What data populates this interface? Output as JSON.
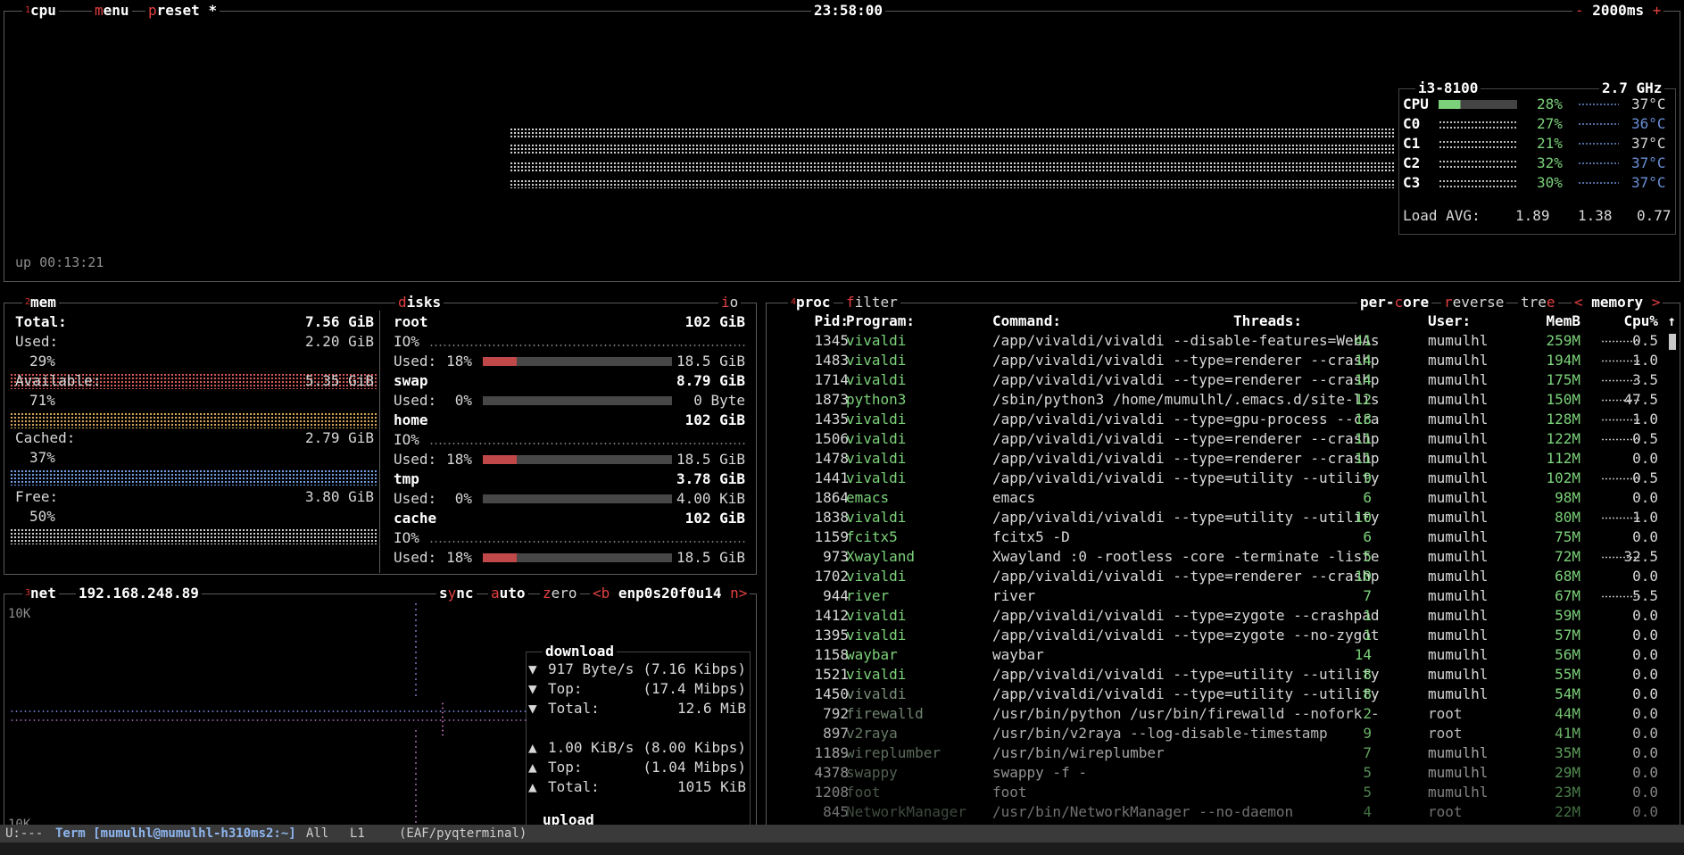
{
  "cpu": {
    "num": "1",
    "title": "cpu",
    "menu": "menu",
    "preset": "preset *",
    "clock": "23:58:00",
    "minus": "-",
    "interval": "2000ms",
    "plus": "+",
    "uptime": "up 00:13:21",
    "model": "i3-8100",
    "freq": "2.7 GHz",
    "cores": [
      {
        "label": "CPU",
        "pct": "28%",
        "temp": "37°C",
        "usage": 0.28
      },
      {
        "label": "C0",
        "pct": "27%",
        "temp": "36°C",
        "usage": 0.27
      },
      {
        "label": "C1",
        "pct": "21%",
        "temp": "37°C",
        "usage": 0.21
      },
      {
        "label": "C2",
        "pct": "32%",
        "temp": "37°C",
        "usage": 0.32
      },
      {
        "label": "C3",
        "pct": "30%",
        "temp": "37°C",
        "usage": 0.3
      }
    ],
    "load_label": "Load AVG:",
    "load": [
      "1.89",
      "1.38",
      "0.77"
    ]
  },
  "mem": {
    "num": "2",
    "title": "mem",
    "rows": [
      {
        "label": "Total:",
        "value": "7.56 GiB",
        "pct": ""
      },
      {
        "label": "Used:",
        "value": "2.20 GiB",
        "pct": "29%"
      },
      {
        "label": "Available:",
        "value": "5.35 GiB",
        "pct": "71%"
      },
      {
        "label": "Cached:",
        "value": "2.79 GiB",
        "pct": "37%"
      },
      {
        "label": "Free:",
        "value": "3.80 GiB",
        "pct": "50%"
      }
    ]
  },
  "disks": {
    "title": "disks",
    "io": "io",
    "items": [
      {
        "name": "root",
        "size": "102 GiB",
        "io": "IO%",
        "used_label": "Used:",
        "used_pct": "18%",
        "used": "18.5 GiB",
        "fill": 0.18
      },
      {
        "name": "swap",
        "size": "8.79 GiB",
        "io": "",
        "used_label": "Used:",
        "used_pct": "0%",
        "used": "0 Byte",
        "fill": 0.0
      },
      {
        "name": "home",
        "size": "102 GiB",
        "io": "IO%",
        "used_label": "Used:",
        "used_pct": "18%",
        "used": "18.5 GiB",
        "fill": 0.18
      },
      {
        "name": "tmp",
        "size": "3.78 GiB",
        "io": "",
        "used_label": "Used:",
        "used_pct": "0%",
        "used": "4.00 KiB",
        "fill": 0.0
      },
      {
        "name": "cache",
        "size": "102 GiB",
        "io": "IO%",
        "used_label": "Used:",
        "used_pct": "18%",
        "used": "18.5 GiB",
        "fill": 0.18
      }
    ]
  },
  "net": {
    "num": "3",
    "title": "net",
    "ip": "192.168.248.89",
    "sync": "sync",
    "auto": "auto",
    "zero": "zero",
    "prev": "<b",
    "iface": "enp0s20f0u14",
    "next": "n>",
    "scale_top": "10K",
    "scale_bottom": "10K",
    "download_title": "download",
    "download": [
      {
        "arrow": "▼",
        "label": "917 Byte/s",
        "value": "(7.16 Kibps)"
      },
      {
        "arrow": "▼",
        "label": "Top:",
        "value": "(17.4 Mibps)"
      },
      {
        "arrow": "▼",
        "label": "Total:",
        "value": "12.6 MiB"
      }
    ],
    "upload": [
      {
        "arrow": "▲",
        "label": "1.00 KiB/s",
        "value": "(8.00 Kibps)"
      },
      {
        "arrow": "▲",
        "label": "Top:",
        "value": "(1.04 Mibps)"
      },
      {
        "arrow": "▲",
        "label": "Total:",
        "value": "1015 KiB"
      }
    ],
    "upload_title": "upload"
  },
  "proc": {
    "num": "4",
    "title": "proc",
    "filter": "filter",
    "per_core": "per-core",
    "reverse": "reverse",
    "tree": "tree",
    "sort_prev": "<",
    "sort": "memory",
    "sort_next": ">",
    "headers": {
      "pid": "Pid:",
      "program": "Program:",
      "command": "Command:",
      "threads": "Threads:",
      "user": "User:",
      "memb": "MemB",
      "cpu": "Cpu%",
      "arrow": "↑"
    },
    "rows": [
      {
        "pid": "1345",
        "program": "vivaldi",
        "command": "/app/vivaldi/vivaldi --disable-features=WebAs",
        "threads": "41",
        "user": "mumulhl",
        "mem": "259M",
        "cpu": "0.5"
      },
      {
        "pid": "1483",
        "program": "vivaldi",
        "command": "/app/vivaldi/vivaldi --type=renderer --crashp",
        "threads": "14",
        "user": "mumulhl",
        "mem": "194M",
        "cpu": "1.0"
      },
      {
        "pid": "1714",
        "program": "vivaldi",
        "command": "/app/vivaldi/vivaldi --type=renderer --crashp",
        "threads": "14",
        "user": "mumulhl",
        "mem": "175M",
        "cpu": "3.5"
      },
      {
        "pid": "1873",
        "program": "python3",
        "command": "/sbin/python3 /home/mumulhl/.emacs.d/site-lis",
        "threads": "12",
        "user": "mumulhl",
        "mem": "150M",
        "cpu": "47.5"
      },
      {
        "pid": "1435",
        "program": "vivaldi",
        "command": "/app/vivaldi/vivaldi --type=gpu-process --cra",
        "threads": "18",
        "user": "mumulhl",
        "mem": "128M",
        "cpu": "1.0"
      },
      {
        "pid": "1506",
        "program": "vivaldi",
        "command": "/app/vivaldi/vivaldi --type=renderer --crashp",
        "threads": "11",
        "user": "mumulhl",
        "mem": "122M",
        "cpu": "0.5"
      },
      {
        "pid": "1478",
        "program": "vivaldi",
        "command": "/app/vivaldi/vivaldi --type=renderer --crashp",
        "threads": "11",
        "user": "mumulhl",
        "mem": "112M",
        "cpu": "0.0"
      },
      {
        "pid": "1441",
        "program": "vivaldi",
        "command": "/app/vivaldi/vivaldi --type=utility --utility",
        "threads": "9",
        "user": "mumulhl",
        "mem": "102M",
        "cpu": "0.5"
      },
      {
        "pid": "1864",
        "program": "emacs",
        "command": "emacs",
        "threads": "6",
        "user": "mumulhl",
        "mem": "98M",
        "cpu": "0.0"
      },
      {
        "pid": "1838",
        "program": "vivaldi",
        "command": "/app/vivaldi/vivaldi --type=utility --utility",
        "threads": "10",
        "user": "mumulhl",
        "mem": "80M",
        "cpu": "1.0"
      },
      {
        "pid": "1159",
        "program": "fcitx5",
        "command": "fcitx5 -D",
        "threads": "6",
        "user": "mumulhl",
        "mem": "75M",
        "cpu": "0.0"
      },
      {
        "pid": "973",
        "program": "Xwayland",
        "command": "Xwayland :0 -rootless -core -terminate -liste",
        "threads": "5",
        "user": "mumulhl",
        "mem": "72M",
        "cpu": "32.5"
      },
      {
        "pid": "1702",
        "program": "vivaldi",
        "command": "/app/vivaldi/vivaldi --type=renderer --crashp",
        "threads": "10",
        "user": "mumulhl",
        "mem": "68M",
        "cpu": "0.0"
      },
      {
        "pid": "944",
        "program": "river",
        "command": "river",
        "threads": "7",
        "user": "mumulhl",
        "mem": "67M",
        "cpu": "5.5"
      },
      {
        "pid": "1412",
        "program": "vivaldi",
        "command": "/app/vivaldi/vivaldi --type=zygote --crashpad",
        "threads": "1",
        "user": "mumulhl",
        "mem": "59M",
        "cpu": "0.0"
      },
      {
        "pid": "1395",
        "program": "vivaldi",
        "command": "/app/vivaldi/vivaldi --type=zygote --no-zygot",
        "threads": "1",
        "user": "mumulhl",
        "mem": "57M",
        "cpu": "0.0"
      },
      {
        "pid": "1158",
        "program": "waybar",
        "command": "waybar",
        "threads": "14",
        "user": "mumulhl",
        "mem": "56M",
        "cpu": "0.0"
      },
      {
        "pid": "1521",
        "program": "vivaldi",
        "command": "/app/vivaldi/vivaldi --type=utility --utility",
        "threads": "8",
        "user": "mumulhl",
        "mem": "55M",
        "cpu": "0.0"
      },
      {
        "pid": "1450",
        "program": "vivaldi",
        "command": "/app/vivaldi/vivaldi --type=utility --utility",
        "threads": "8",
        "user": "mumulhl",
        "mem": "54M",
        "cpu": "0.0"
      },
      {
        "pid": "792",
        "program": "firewalld",
        "command": "/usr/bin/python /usr/bin/firewalld --nofork -",
        "threads": "2",
        "user": "root",
        "mem": "44M",
        "cpu": "0.0"
      },
      {
        "pid": "897",
        "program": "v2raya",
        "command": "/usr/bin/v2raya --log-disable-timestamp",
        "threads": "9",
        "user": "root",
        "mem": "41M",
        "cpu": "0.0"
      },
      {
        "pid": "1189",
        "program": "wireplumber",
        "command": "/usr/bin/wireplumber",
        "threads": "7",
        "user": "mumulhl",
        "mem": "35M",
        "cpu": "0.0"
      },
      {
        "pid": "4378",
        "program": "swappy",
        "command": "swappy -f -",
        "threads": "5",
        "user": "mumulhl",
        "mem": "29M",
        "cpu": "0.0"
      },
      {
        "pid": "1208",
        "program": "foot",
        "command": "foot",
        "threads": "5",
        "user": "mumulhl",
        "mem": "23M",
        "cpu": "0.0"
      },
      {
        "pid": "845",
        "program": "NetworkManager",
        "command": "/usr/bin/NetworkManager --no-daemon",
        "threads": "4",
        "user": "root",
        "mem": "22M",
        "cpu": "0.0"
      }
    ]
  },
  "status": {
    "mode": "U:---",
    "buffer": "Term [mumulhl@mumulhl-h310ms2:~]",
    "all": "All",
    "line": "L1",
    "major": "(EAF/pyqterminal)"
  }
}
